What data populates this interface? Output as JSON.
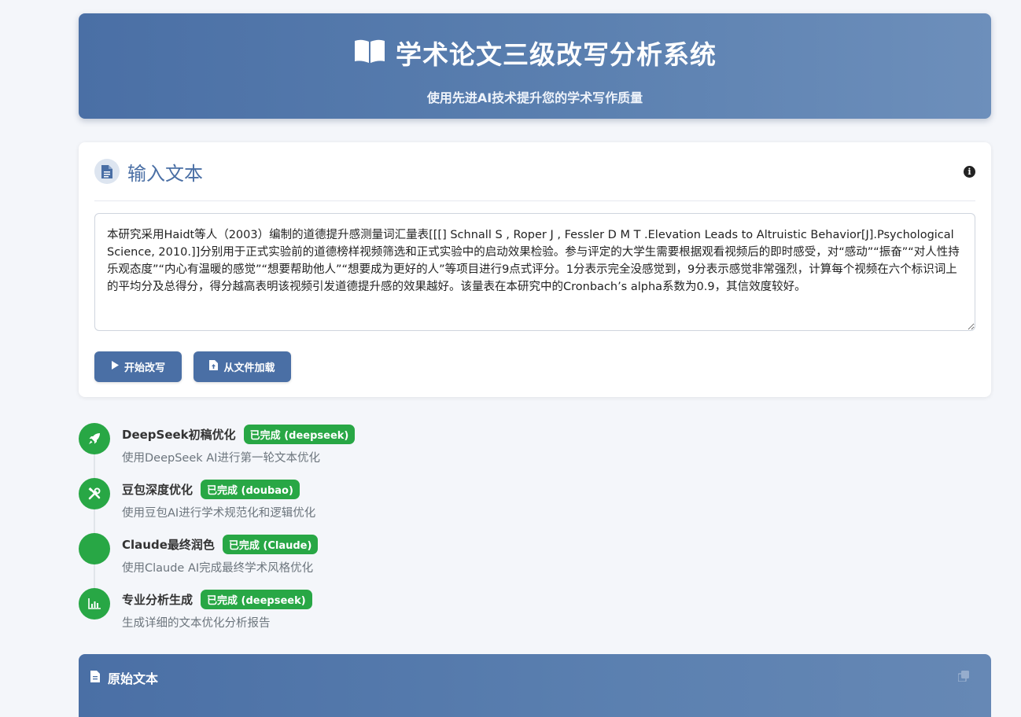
{
  "header": {
    "title": "学术论文三级改写分析系统",
    "subtitle": "使用先进AI技术提升您的学术写作质量",
    "icon": "book-open-icon"
  },
  "input_card": {
    "title": "输入文本",
    "icon": "file-text-icon",
    "info_icon": "info-circle-icon",
    "text": "本研究采用Haidt等人（2003）编制的道德提升感测量词汇量表[[[] Schnall S , Roper J , Fessler D M T .Elevation Leads to Altruistic Behavior[J].Psychological Science, 2010.]]分别用于正式实验前的道德榜样视频筛选和正式实验中的启动效果检验。参与评定的大学生需要根据观看视频后的即时感受，对“感动”“振奋”“对人性持乐观态度”“内心有温暖的感觉”“想要帮助他人”“想要成为更好的人”等项目进行9点式评分。1分表示完全没感觉到，9分表示感觉非常强烈，计算每个视频在六个标识词上的平均分及总得分，得分越高表明该视频引发道德提升感的效果越好。该量表在本研究中的Cronbach’s alpha系数为0.9，其信效度较好。",
    "start_button": "开始改写",
    "load_button": "从文件加载"
  },
  "steps": [
    {
      "name": "DeepSeek初稿优化",
      "status": "已完成 (deepseek)",
      "desc": "使用DeepSeek AI进行第一轮文本优化",
      "icon": "rocket-icon"
    },
    {
      "name": "豆包深度优化",
      "status": "已完成 (doubao)",
      "desc": "使用豆包AI进行学术规范化和逻辑优化",
      "icon": "tools-icon"
    },
    {
      "name": "Claude最终润色",
      "status": "已完成 (Claude)",
      "desc": "使用Claude AI完成最终学术风格优化",
      "icon": "blank-icon"
    },
    {
      "name": "专业分析生成",
      "status": "已完成 (deepseek)",
      "desc": "生成详细的文本优化分析报告",
      "icon": "chart-bar-icon"
    }
  ],
  "original_panel": {
    "title": "原始文本",
    "icon": "file-icon",
    "copy_icon": "copy-icon"
  },
  "colors": {
    "primary": "#4a6fa5",
    "success": "#28a745",
    "background": "#f4f6fa"
  }
}
